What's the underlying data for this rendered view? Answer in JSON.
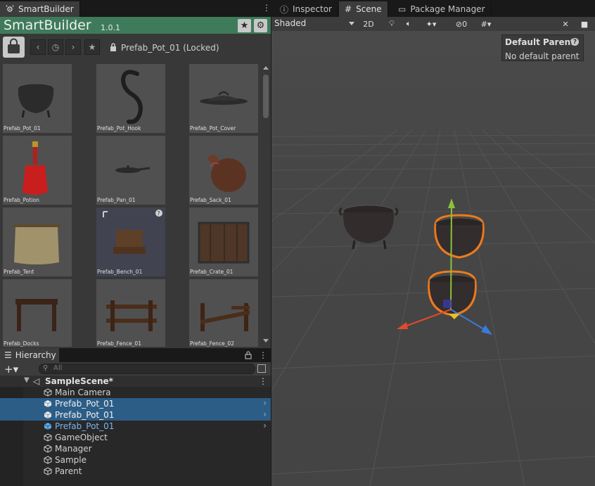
{
  "smartbuilder": {
    "tab_label": "SmartBuilder",
    "title": "SmartBuilder",
    "version": "1.0.1",
    "locked_label": "Prefab_Pot_01 (Locked)",
    "assets": [
      {
        "label": "Prefab_Pot_01",
        "icon": "pot-icon"
      },
      {
        "label": "Prefab_Pot_Hook",
        "icon": "hook-icon"
      },
      {
        "label": "Prefab_Pot_Cover",
        "icon": "pot-cover-icon"
      },
      {
        "label": "Prefab_Potion",
        "icon": "potion-icon"
      },
      {
        "label": "Prefab_Pan_01",
        "icon": "pan-icon"
      },
      {
        "label": "Prefab_Sack_01",
        "icon": "sack-icon"
      },
      {
        "label": "Prefab_Tent",
        "icon": "tent-icon"
      },
      {
        "label": "Prefab_Bench_01",
        "icon": "bench-icon"
      },
      {
        "label": "Prefab_Crate_01",
        "icon": "crate-icon"
      },
      {
        "label": "Prefab_Docks",
        "icon": "docks-icon"
      },
      {
        "label": "Prefab_Fence_01",
        "icon": "fence-icon"
      },
      {
        "label": "Prefab_Fence_02",
        "icon": "broken-fence-icon"
      }
    ]
  },
  "hierarchy": {
    "tab_label": "Hierarchy",
    "search_placeholder": "All",
    "scene_name": "SampleScene*",
    "items": [
      {
        "label": "Main Camera",
        "selected": false,
        "prefab": false
      },
      {
        "label": "Prefab_Pot_01",
        "selected": true,
        "prefab": true
      },
      {
        "label": "Prefab_Pot_01",
        "selected": true,
        "prefab": true
      },
      {
        "label": "Prefab_Pot_01",
        "selected": false,
        "prefab": true
      },
      {
        "label": "GameObject",
        "selected": false,
        "prefab": false
      },
      {
        "label": "Manager",
        "selected": false,
        "prefab": false
      },
      {
        "label": "Sample",
        "selected": false,
        "prefab": false
      },
      {
        "label": "Parent",
        "selected": false,
        "prefab": false
      }
    ]
  },
  "right_tabs": [
    {
      "label": "Inspector",
      "icon": "info-icon"
    },
    {
      "label": "Scene",
      "icon": "grid-icon"
    },
    {
      "label": "Package Manager",
      "icon": "package-icon"
    }
  ],
  "scene_toolbar": {
    "shading_mode": "Shaded",
    "mode_2d": "2D",
    "hidden_count": "0"
  },
  "overlay": {
    "title": "Default Parent",
    "value": "No default parent"
  },
  "colors": {
    "header_green": "#3e7b5a",
    "selection_blue": "#2c5d87",
    "viewport_gray": "#464646",
    "selection_outline": "#f07a1a"
  }
}
